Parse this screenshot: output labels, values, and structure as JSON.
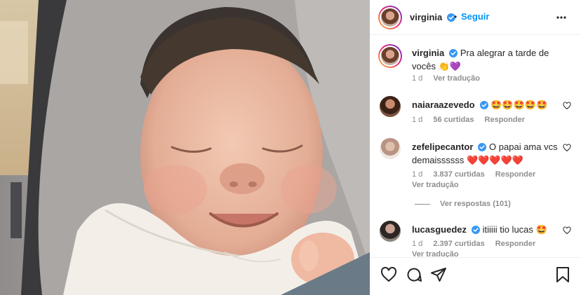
{
  "post": {
    "author": "virginia",
    "follow_label": "Seguir",
    "separator": "•",
    "caption": "Pra alegrar a tarde de vocês 👏💜",
    "time": "1 d",
    "translate": "Ver tradução"
  },
  "comments": [
    {
      "user": "naiaraazevedo",
      "text": "🤩🤩🤩🤩🤩",
      "time": "1 d",
      "likes": "56 curtidas",
      "reply": "Responder"
    },
    {
      "user": "zefelipecantor",
      "text": "O papai ama vcs demaissssss ❤️❤️❤️❤️❤️",
      "time": "1 d",
      "likes": "3.837 curtidas",
      "reply": "Responder",
      "translate": "Ver tradução",
      "view_replies": "Ver respostas (101)"
    },
    {
      "user": "lucasguedez",
      "text": "itiiiii tio lucas 🤩",
      "time": "1 d",
      "likes": "2.397 curtidas",
      "reply": "Responder",
      "translate": "Ver tradução"
    }
  ],
  "colors": {
    "accent": "#0095f6",
    "verified": "#3897f0",
    "muted": "#8e8e8e",
    "text": "#262626"
  },
  "icons": [
    "heart-icon",
    "comment-icon",
    "share-icon",
    "bookmark-icon",
    "more-icon",
    "verified-icon"
  ]
}
